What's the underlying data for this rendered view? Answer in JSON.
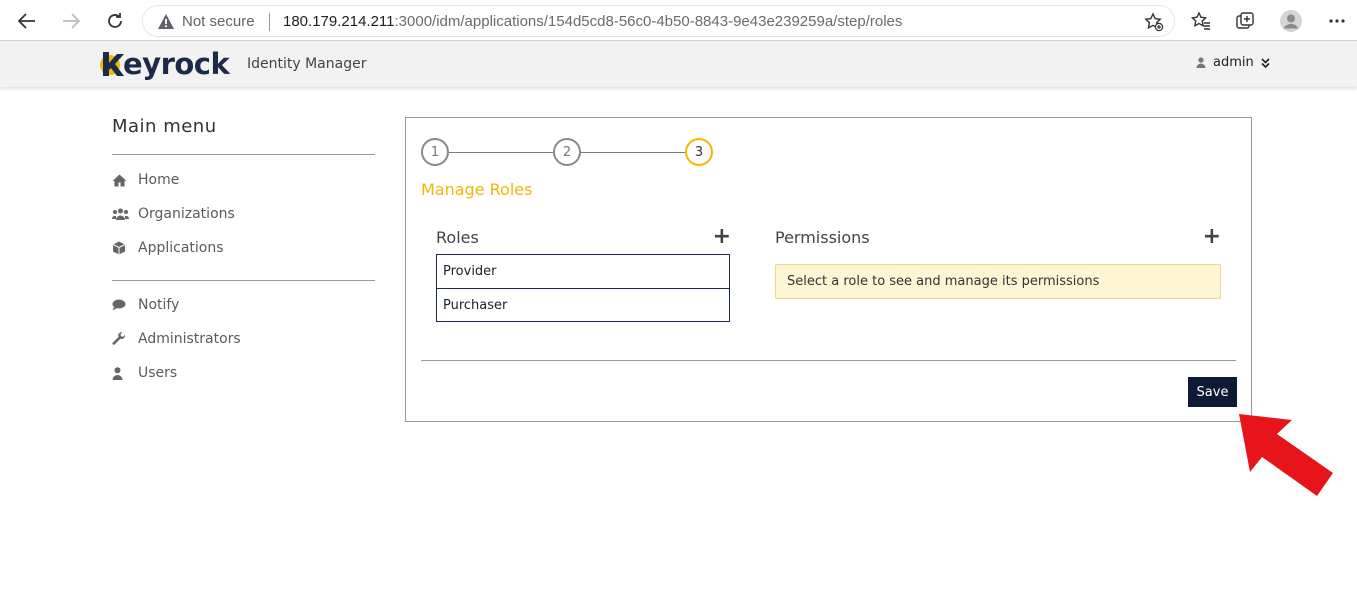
{
  "browser": {
    "security_label": "Not secure",
    "url_host": "180.179.214.211",
    "url_path": ":3000/idm/applications/154d5cd8-56c0-4b50-8843-9e43e239259a/step/roles"
  },
  "header": {
    "logo_text": "eyrock",
    "subtitle": "Identity Manager",
    "user_name": "admin"
  },
  "sidebar": {
    "title": "Main menu",
    "items_primary": [
      {
        "label": "Home",
        "icon": "home-icon"
      },
      {
        "label": "Organizations",
        "icon": "users-icon"
      },
      {
        "label": "Applications",
        "icon": "cube-icon"
      }
    ],
    "items_secondary": [
      {
        "label": "Notify",
        "icon": "comment-icon"
      },
      {
        "label": "Administrators",
        "icon": "wrench-icon"
      },
      {
        "label": "Users",
        "icon": "user-icon"
      }
    ]
  },
  "wizard": {
    "steps": [
      "1",
      "2",
      "3"
    ],
    "active_step": 3,
    "title": "Manage Roles"
  },
  "roles": {
    "title": "Roles",
    "add_label": "+",
    "items": [
      "Provider",
      "Purchaser"
    ]
  },
  "permissions": {
    "title": "Permissions",
    "add_label": "+",
    "note": "Select a role to see and manage its permissions"
  },
  "actions": {
    "save_label": "Save"
  },
  "colors": {
    "accent": "#f2b705",
    "navy": "#0d1a33",
    "annotation_arrow": "#e8141c"
  }
}
